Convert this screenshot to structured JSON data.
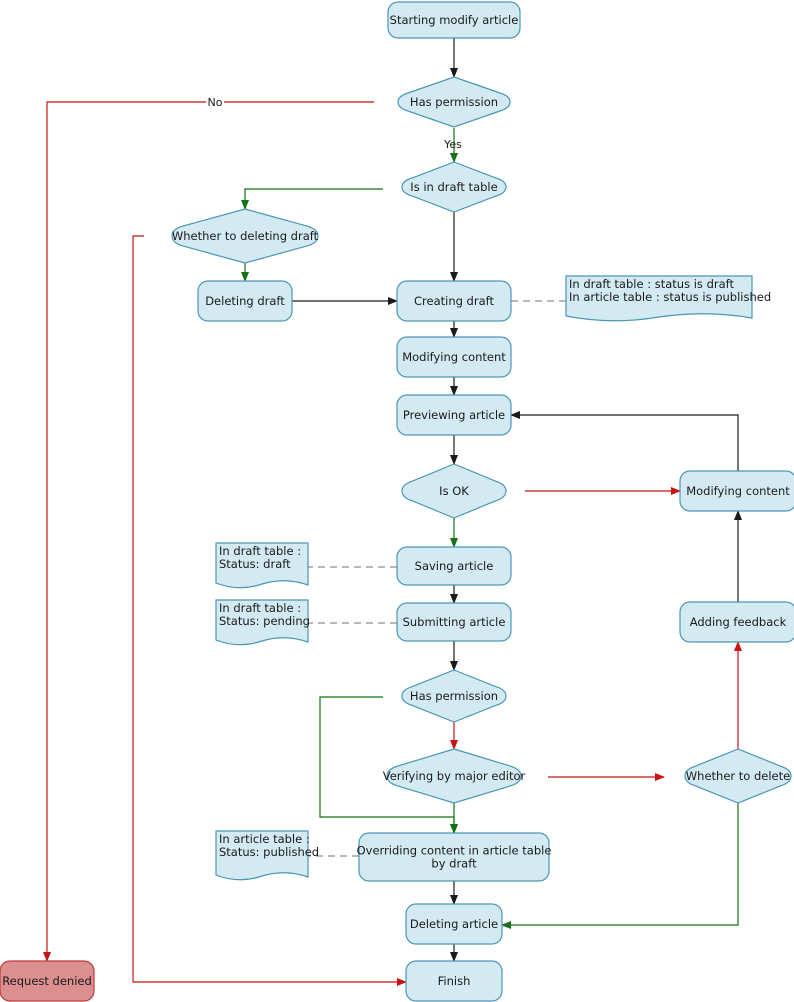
{
  "diagram": {
    "type": "flowchart",
    "colors": {
      "node_fill": "#d3eaf2",
      "node_stroke": "#4b96b4",
      "denied_fill": "#dc8f8f",
      "denied_stroke": "#c23b3b",
      "black_edge": "#1a1a1a",
      "red_edge": "#c81414",
      "green_edge": "#137213",
      "dashed_edge": "#a0a0a0"
    },
    "nodes": [
      {
        "id": "start",
        "shape": "rounded",
        "lines": [
          "Starting modify article"
        ]
      },
      {
        "id": "perm1",
        "shape": "decision",
        "lines": [
          "Has permission"
        ]
      },
      {
        "id": "indraft",
        "shape": "decision",
        "lines": [
          "Is in draft table"
        ]
      },
      {
        "id": "whetherdel",
        "shape": "decision",
        "lines": [
          "Whether to deleting draft"
        ]
      },
      {
        "id": "deldraft",
        "shape": "rounded",
        "lines": [
          "Deleting draft"
        ]
      },
      {
        "id": "createdraft",
        "shape": "rounded",
        "lines": [
          "Creating draft"
        ]
      },
      {
        "id": "note1",
        "shape": "document",
        "lines": [
          "In draft table : status is draft",
          "In article table : status is published"
        ]
      },
      {
        "id": "modify1",
        "shape": "rounded",
        "lines": [
          "Modifying content"
        ]
      },
      {
        "id": "preview",
        "shape": "rounded",
        "lines": [
          "Previewing article"
        ]
      },
      {
        "id": "isok",
        "shape": "decision",
        "lines": [
          "Is OK"
        ]
      },
      {
        "id": "modify2",
        "shape": "rounded",
        "lines": [
          "Modifying content"
        ]
      },
      {
        "id": "save",
        "shape": "rounded",
        "lines": [
          "Saving article"
        ]
      },
      {
        "id": "note2",
        "shape": "document",
        "lines": [
          "In draft table :",
          "Status: draft"
        ]
      },
      {
        "id": "submit",
        "shape": "rounded",
        "lines": [
          "Submitting article"
        ]
      },
      {
        "id": "note3",
        "shape": "document",
        "lines": [
          "In draft table :",
          "Status: pending"
        ]
      },
      {
        "id": "feedback",
        "shape": "rounded",
        "lines": [
          "Adding feedback"
        ]
      },
      {
        "id": "perm2",
        "shape": "decision",
        "lines": [
          "Has permission"
        ]
      },
      {
        "id": "verify",
        "shape": "decision",
        "lines": [
          "Verifying by major editor"
        ]
      },
      {
        "id": "whetherdelete",
        "shape": "decision",
        "lines": [
          "Whether to delete"
        ]
      },
      {
        "id": "override",
        "shape": "rounded",
        "lines": [
          "Overriding content in article table",
          "by draft"
        ]
      },
      {
        "id": "note4",
        "shape": "document",
        "lines": [
          "In article table :",
          "Status: published"
        ]
      },
      {
        "id": "delarticle",
        "shape": "rounded",
        "lines": [
          "Deleting article"
        ]
      },
      {
        "id": "finish",
        "shape": "rounded",
        "lines": [
          "Finish"
        ]
      },
      {
        "id": "denied",
        "shape": "rounded-denied",
        "lines": [
          "Request denied"
        ]
      }
    ],
    "edges": [
      {
        "from": "start",
        "to": "perm1",
        "color": "black"
      },
      {
        "from": "perm1",
        "to": "indraft",
        "color": "green",
        "label": "Yes"
      },
      {
        "from": "perm1",
        "to": "denied",
        "color": "red",
        "label": "No"
      },
      {
        "from": "indraft",
        "to": "whetherdel",
        "color": "green"
      },
      {
        "from": "indraft",
        "to": "createdraft",
        "color": "black"
      },
      {
        "from": "whetherdel",
        "to": "deldraft",
        "color": "green"
      },
      {
        "from": "whetherdel",
        "to": "finish",
        "color": "red"
      },
      {
        "from": "deldraft",
        "to": "createdraft",
        "color": "black"
      },
      {
        "from": "createdraft",
        "to": "note1",
        "color": "dashed"
      },
      {
        "from": "createdraft",
        "to": "modify1",
        "color": "black"
      },
      {
        "from": "modify1",
        "to": "preview",
        "color": "black"
      },
      {
        "from": "preview",
        "to": "isok",
        "color": "black"
      },
      {
        "from": "isok",
        "to": "modify2",
        "color": "red"
      },
      {
        "from": "modify2",
        "to": "preview",
        "color": "black"
      },
      {
        "from": "isok",
        "to": "save",
        "color": "green"
      },
      {
        "from": "save",
        "to": "note2",
        "color": "dashed"
      },
      {
        "from": "save",
        "to": "submit",
        "color": "black"
      },
      {
        "from": "submit",
        "to": "note3",
        "color": "dashed"
      },
      {
        "from": "submit",
        "to": "perm2",
        "color": "black"
      },
      {
        "from": "perm2",
        "to": "verify",
        "color": "red"
      },
      {
        "from": "perm2",
        "to": "override",
        "color": "green"
      },
      {
        "from": "verify",
        "to": "override",
        "color": "green"
      },
      {
        "from": "verify",
        "to": "whetherdelete",
        "color": "red"
      },
      {
        "from": "whetherdelete",
        "to": "feedback",
        "color": "red"
      },
      {
        "from": "whetherdelete",
        "to": "delarticle",
        "color": "green"
      },
      {
        "from": "feedback",
        "to": "modify2",
        "color": "black"
      },
      {
        "from": "override",
        "to": "note4",
        "color": "dashed"
      },
      {
        "from": "override",
        "to": "delarticle",
        "color": "black"
      },
      {
        "from": "delarticle",
        "to": "finish",
        "color": "black"
      }
    ]
  }
}
